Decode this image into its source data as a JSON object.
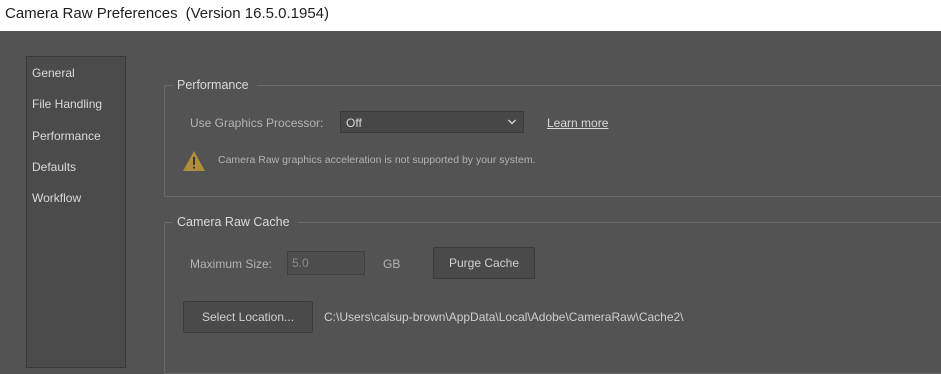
{
  "window": {
    "title": "Camera Raw Preferences",
    "version": "(Version 16.5.0.1954)"
  },
  "sidebar": {
    "items": [
      {
        "label": "General"
      },
      {
        "label": "File Handling"
      },
      {
        "label": "Performance"
      },
      {
        "label": "Defaults"
      },
      {
        "label": "Workflow"
      }
    ]
  },
  "performance": {
    "legend": "Performance",
    "gpu_label": "Use Graphics Processor:",
    "gpu_value": "Off",
    "learn_more": "Learn more",
    "warning_text": "Camera Raw graphics acceleration is not supported by your system."
  },
  "cache": {
    "legend": "Camera Raw Cache",
    "max_size_label": "Maximum Size:",
    "max_size_value": "5.0",
    "unit": "GB",
    "purge_button": "Purge Cache",
    "select_location_button": "Select Location...",
    "path": "C:\\Users\\calsup-brown\\AppData\\Local\\Adobe\\CameraRaw\\Cache2\\"
  },
  "icons": {
    "warning": "warning-icon",
    "dropdown": "chevron-down-icon"
  },
  "colors": {
    "background": "#535353",
    "warning": "#b08d3c"
  }
}
